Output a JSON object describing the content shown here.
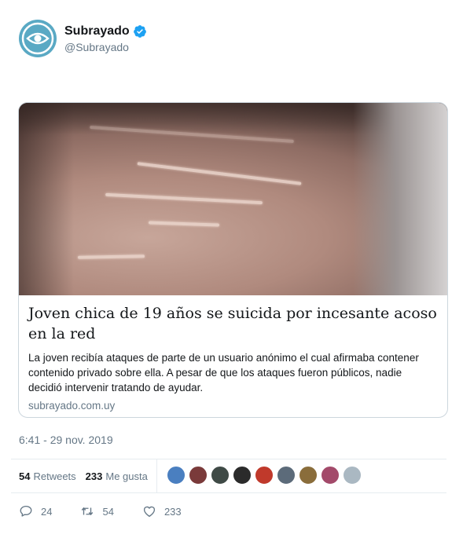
{
  "author": {
    "display_name": "Subrayado",
    "handle": "@Subrayado",
    "brand_color": "#5aa9c4",
    "verified_color": "#1da1f2"
  },
  "card": {
    "title": "Joven chica de 19 años se suicida por incesante acoso en la red",
    "description": "La joven recibía ataques de parte de un usuario anónimo el cual afirmaba contener contenido privado sobre ella. A pesar de que los ataques fueron públicos, nadie decidió intervenir tratando de ayudar.",
    "domain": "subrayado.com.uy"
  },
  "timestamp": "6:41 - 29 nov. 2019",
  "stats": {
    "retweets_count": "54",
    "retweets_label": "Retweets",
    "likes_count": "233",
    "likes_label": "Me gusta"
  },
  "liker_colors": [
    "#4a7fc0",
    "#7a3a3a",
    "#3f4a46",
    "#2b2b2b",
    "#c0392b",
    "#5c6b7a",
    "#8a6d3b",
    "#a34a6a",
    "#aab8c2"
  ],
  "actions": {
    "reply_count": "24",
    "retweet_count": "54",
    "like_count": "233"
  }
}
